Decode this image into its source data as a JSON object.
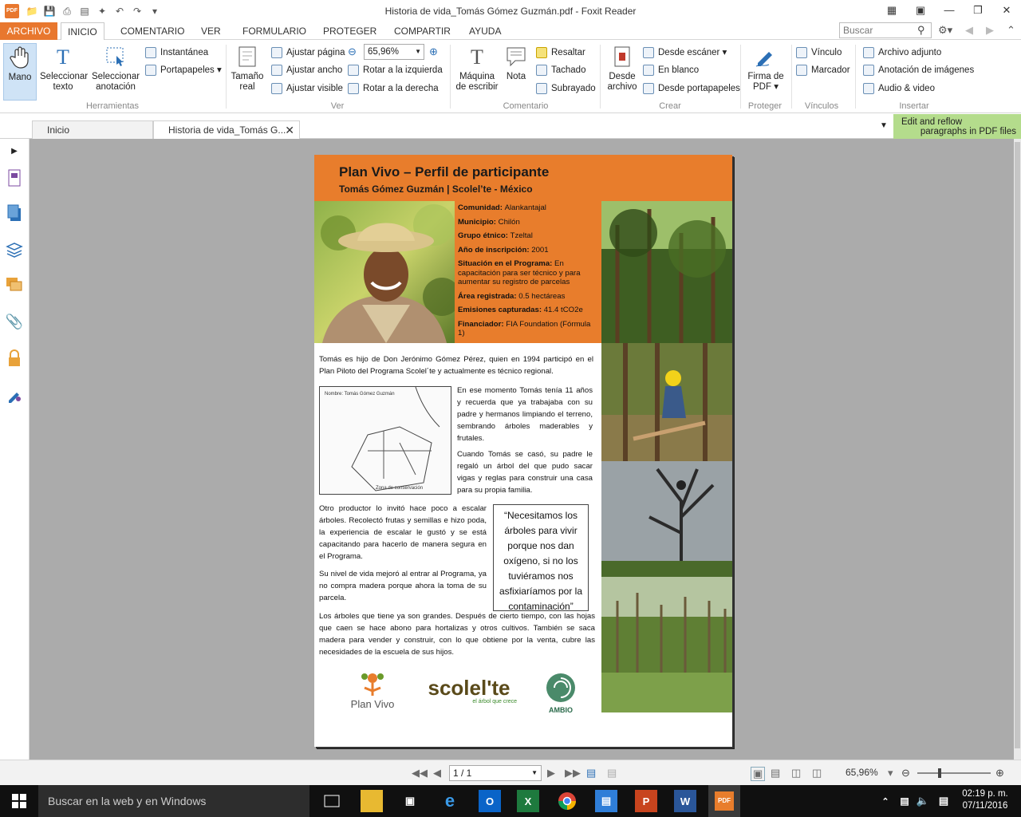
{
  "window": {
    "title": "Historia de vida_Tomás Gómez Guzmán.pdf - Foxit Reader"
  },
  "menu": {
    "tabs": [
      "ARCHIVO",
      "INICIO",
      "COMENTARIO",
      "VER",
      "FORMULARIO",
      "PROTEGER",
      "COMPARTIR",
      "AYUDA"
    ],
    "search_placeholder": "Buscar"
  },
  "ribbon": {
    "herramientas": {
      "hand": "Mano",
      "select_text_1": "Seleccionar",
      "select_text_2": "texto",
      "select_annot_1": "Seleccionar",
      "select_annot_2": "anotación",
      "snapshot": "Instantánea",
      "clipboard": "Portapapeles",
      "group": "Herramientas"
    },
    "ver": {
      "actual_1": "Tamaño",
      "actual_2": "real",
      "fit_page": "Ajustar página",
      "fit_width": "Ajustar ancho",
      "fit_visible": "Ajustar visible",
      "zoom": "65,96%",
      "rotate_left": "Rotar a la izquierda",
      "rotate_right": "Rotar a la derecha",
      "group": "Ver"
    },
    "comentario": {
      "typewriter_1": "Máquina",
      "typewriter_2": "de escribir",
      "note": "Nota",
      "highlight": "Resaltar",
      "strikeout": "Tachado",
      "underline": "Subrayado",
      "group": "Comentario"
    },
    "crear": {
      "from_file_1": "Desde",
      "from_file_2": "archivo",
      "from_scanner": "Desde escáner",
      "blank": "En blanco",
      "from_clipboard": "Desde portapapeles",
      "group": "Crear"
    },
    "proteger": {
      "sign_1": "Firma de",
      "sign_2": "PDF",
      "group": "Proteger"
    },
    "vinculos": {
      "link": "Vínculo",
      "bookmark": "Marcador",
      "group": "Vínculos"
    },
    "insertar": {
      "attachment": "Archivo adjunto",
      "image": "Anotación de imágenes",
      "media": "Audio & video",
      "group": "Insertar"
    }
  },
  "doc_tabs": {
    "home": "Inicio",
    "doc": "Historia de vida_Tomás G..."
  },
  "reflow": {
    "line1": "Edit and reflow",
    "line2": "paragraphs in PDF files"
  },
  "pdf": {
    "title": "Plan Vivo – Perfil de participante",
    "subtitle": "Tomás Gómez Guzmán | Scolel’te - México",
    "info": [
      {
        "label": "Comunidad",
        "value": "Alankantajal"
      },
      {
        "label": "Municipio",
        "value": "Chilón"
      },
      {
        "label": "Grupo étnico",
        "value": "Tzeltal"
      },
      {
        "label": "Año de inscripción",
        "value": "2001"
      },
      {
        "label": "Situación en el Programa",
        "value": "En capacitación para ser técnico y para aumentar su registro de parcelas"
      },
      {
        "label": "Área registrada",
        "value": "0.5 hectáreas"
      },
      {
        "label": "Emisiones capturadas",
        "value": "41.4 tCO2e"
      },
      {
        "label": "Financiador",
        "value": "FIA Foundation (Fórmula 1)"
      }
    ],
    "p1": "Tomás es hijo de Don Jerónimo Gómez Pérez, quien en 1994 participó en el Plan Piloto del Programa Scolel´te y actualmente es técnico regional.",
    "p2": "En ese momento Tomás tenía 11 años y recuerda que ya trabajaba con su padre y hermanos limpiando el terreno, sembrando árboles maderables y frutales.",
    "p3": "Cuando Tomás se casó, su padre le regaló un árbol del que pudo sacar vigas y reglas para construir una casa para su propia familia.",
    "p4": "Otro productor lo invitó hace poco a escalar árboles. Recolectó frutas y semillas e hizo poda, la experiencia de escalar le gustó y se está capacitando para hacerlo de manera segura en el Programa.",
    "p5": "Su nivel de vida mejoró al entrar al Programa, ya no compra madera porque ahora la toma de su parcela.",
    "p6": "Los árboles que tiene ya son grandes. Después de cierto tiempo, con las hojas que caen se hace abono para hortalizas y otros cultivos. También se saca madera para vender y construir, con lo que obtiene por la venta, cubre las necesidades de la escuela de sus hijos.",
    "quote": "“Necesitamos los árboles para vivir porque nos dan oxígeno, si no los tuviéramos nos asfixiaríamos por la contaminación”",
    "logos": {
      "planvivo": "Plan Vivo",
      "scolelte": "scolel'te",
      "scolelte_tag": "el árbol que crece",
      "ambio": "AMBIO"
    }
  },
  "statusbar": {
    "page": "1 / 1",
    "zoom": "65,96%"
  },
  "taskbar": {
    "search": "Buscar en la web y en Windows",
    "time": "02:19 p. m.",
    "date": "07/11/2016"
  },
  "colors": {
    "accent": "#e87d2c",
    "reflow": "#b4dc8c",
    "taskbar": "#101010"
  }
}
